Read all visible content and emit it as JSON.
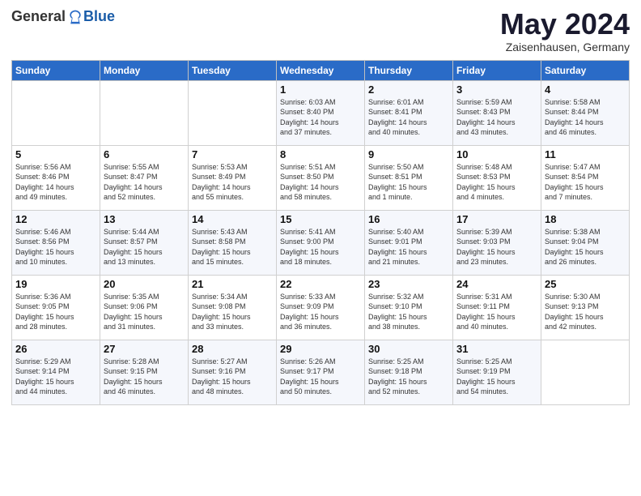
{
  "header": {
    "logo_general": "General",
    "logo_blue": "Blue",
    "title": "May 2024",
    "location": "Zaisenhausen, Germany"
  },
  "days_of_week": [
    "Sunday",
    "Monday",
    "Tuesday",
    "Wednesday",
    "Thursday",
    "Friday",
    "Saturday"
  ],
  "weeks": [
    {
      "days": [
        {
          "num": "",
          "info": ""
        },
        {
          "num": "",
          "info": ""
        },
        {
          "num": "",
          "info": ""
        },
        {
          "num": "1",
          "info": "Sunrise: 6:03 AM\nSunset: 8:40 PM\nDaylight: 14 hours\nand 37 minutes."
        },
        {
          "num": "2",
          "info": "Sunrise: 6:01 AM\nSunset: 8:41 PM\nDaylight: 14 hours\nand 40 minutes."
        },
        {
          "num": "3",
          "info": "Sunrise: 5:59 AM\nSunset: 8:43 PM\nDaylight: 14 hours\nand 43 minutes."
        },
        {
          "num": "4",
          "info": "Sunrise: 5:58 AM\nSunset: 8:44 PM\nDaylight: 14 hours\nand 46 minutes."
        }
      ]
    },
    {
      "days": [
        {
          "num": "5",
          "info": "Sunrise: 5:56 AM\nSunset: 8:46 PM\nDaylight: 14 hours\nand 49 minutes."
        },
        {
          "num": "6",
          "info": "Sunrise: 5:55 AM\nSunset: 8:47 PM\nDaylight: 14 hours\nand 52 minutes."
        },
        {
          "num": "7",
          "info": "Sunrise: 5:53 AM\nSunset: 8:49 PM\nDaylight: 14 hours\nand 55 minutes."
        },
        {
          "num": "8",
          "info": "Sunrise: 5:51 AM\nSunset: 8:50 PM\nDaylight: 14 hours\nand 58 minutes."
        },
        {
          "num": "9",
          "info": "Sunrise: 5:50 AM\nSunset: 8:51 PM\nDaylight: 15 hours\nand 1 minute."
        },
        {
          "num": "10",
          "info": "Sunrise: 5:48 AM\nSunset: 8:53 PM\nDaylight: 15 hours\nand 4 minutes."
        },
        {
          "num": "11",
          "info": "Sunrise: 5:47 AM\nSunset: 8:54 PM\nDaylight: 15 hours\nand 7 minutes."
        }
      ]
    },
    {
      "days": [
        {
          "num": "12",
          "info": "Sunrise: 5:46 AM\nSunset: 8:56 PM\nDaylight: 15 hours\nand 10 minutes."
        },
        {
          "num": "13",
          "info": "Sunrise: 5:44 AM\nSunset: 8:57 PM\nDaylight: 15 hours\nand 13 minutes."
        },
        {
          "num": "14",
          "info": "Sunrise: 5:43 AM\nSunset: 8:58 PM\nDaylight: 15 hours\nand 15 minutes."
        },
        {
          "num": "15",
          "info": "Sunrise: 5:41 AM\nSunset: 9:00 PM\nDaylight: 15 hours\nand 18 minutes."
        },
        {
          "num": "16",
          "info": "Sunrise: 5:40 AM\nSunset: 9:01 PM\nDaylight: 15 hours\nand 21 minutes."
        },
        {
          "num": "17",
          "info": "Sunrise: 5:39 AM\nSunset: 9:03 PM\nDaylight: 15 hours\nand 23 minutes."
        },
        {
          "num": "18",
          "info": "Sunrise: 5:38 AM\nSunset: 9:04 PM\nDaylight: 15 hours\nand 26 minutes."
        }
      ]
    },
    {
      "days": [
        {
          "num": "19",
          "info": "Sunrise: 5:36 AM\nSunset: 9:05 PM\nDaylight: 15 hours\nand 28 minutes."
        },
        {
          "num": "20",
          "info": "Sunrise: 5:35 AM\nSunset: 9:06 PM\nDaylight: 15 hours\nand 31 minutes."
        },
        {
          "num": "21",
          "info": "Sunrise: 5:34 AM\nSunset: 9:08 PM\nDaylight: 15 hours\nand 33 minutes."
        },
        {
          "num": "22",
          "info": "Sunrise: 5:33 AM\nSunset: 9:09 PM\nDaylight: 15 hours\nand 36 minutes."
        },
        {
          "num": "23",
          "info": "Sunrise: 5:32 AM\nSunset: 9:10 PM\nDaylight: 15 hours\nand 38 minutes."
        },
        {
          "num": "24",
          "info": "Sunrise: 5:31 AM\nSunset: 9:11 PM\nDaylight: 15 hours\nand 40 minutes."
        },
        {
          "num": "25",
          "info": "Sunrise: 5:30 AM\nSunset: 9:13 PM\nDaylight: 15 hours\nand 42 minutes."
        }
      ]
    },
    {
      "days": [
        {
          "num": "26",
          "info": "Sunrise: 5:29 AM\nSunset: 9:14 PM\nDaylight: 15 hours\nand 44 minutes."
        },
        {
          "num": "27",
          "info": "Sunrise: 5:28 AM\nSunset: 9:15 PM\nDaylight: 15 hours\nand 46 minutes."
        },
        {
          "num": "28",
          "info": "Sunrise: 5:27 AM\nSunset: 9:16 PM\nDaylight: 15 hours\nand 48 minutes."
        },
        {
          "num": "29",
          "info": "Sunrise: 5:26 AM\nSunset: 9:17 PM\nDaylight: 15 hours\nand 50 minutes."
        },
        {
          "num": "30",
          "info": "Sunrise: 5:25 AM\nSunset: 9:18 PM\nDaylight: 15 hours\nand 52 minutes."
        },
        {
          "num": "31",
          "info": "Sunrise: 5:25 AM\nSunset: 9:19 PM\nDaylight: 15 hours\nand 54 minutes."
        },
        {
          "num": "",
          "info": ""
        }
      ]
    }
  ]
}
